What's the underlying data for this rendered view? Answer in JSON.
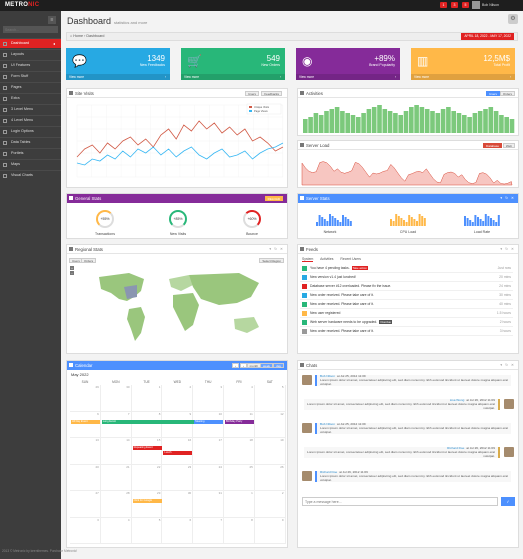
{
  "brand": {
    "name_a": "METRO",
    "name_b": "NIC"
  },
  "topbar": {
    "badges": [
      "1",
      "3",
      "5",
      "3"
    ],
    "user": "Bob Nilson"
  },
  "sidebar": {
    "search_placeholder": "Search...",
    "items": [
      "Dashboard",
      "Layouts",
      "UI Features",
      "Form Stuff",
      "Pages",
      "Extra",
      "3 Level Menu",
      "4 Level Menu",
      "Login Options",
      "Data Tables",
      "Portlets",
      "Maps",
      "Visual Charts"
    ]
  },
  "page": {
    "title": "Dashboard",
    "subtitle": "statistics and more"
  },
  "breadcrumb": {
    "home": "Home",
    "current": "Dashboard",
    "date_range": "APRIL 18, 2022 - MAY 17, 2022"
  },
  "stats": [
    {
      "icon": "comments-icon",
      "value": "1349",
      "label": "New Feedbacks",
      "more": "View more",
      "color": "#27a9e3"
    },
    {
      "icon": "cart-icon",
      "value": "549",
      "label": "New Orders",
      "more": "View more",
      "color": "#28b779"
    },
    {
      "icon": "globe-icon",
      "value": "+89%",
      "label": "Brand Popularity",
      "more": "View more",
      "color": "#852b99"
    },
    {
      "icon": "bar-chart-icon",
      "value": "12,5M$",
      "label": "Total Profit",
      "more": "View more",
      "color": "#ffb848"
    }
  ],
  "site_visits": {
    "title": "Site Visits",
    "buttons": [
      "Users",
      "Feedbacks"
    ],
    "legend": [
      "Unique Visits",
      "Page Views"
    ]
  },
  "activities": {
    "title": "Activities",
    "buttons": [
      "Users",
      "Orders"
    ]
  },
  "server_load": {
    "title": "Server Load",
    "buttons": [
      "Database",
      "Web"
    ]
  },
  "general_stats": {
    "title": "General Stats",
    "button": "RELOAD",
    "gauges": [
      {
        "value": "+55%",
        "label": "Transactions"
      },
      {
        "value": "+85%",
        "label": "New Visits"
      },
      {
        "value": "+60%",
        "label": "Bounce"
      }
    ]
  },
  "server_stats": {
    "title": "Server Stats",
    "labels": [
      "Network",
      "CPU Load",
      "Load Rate"
    ]
  },
  "regional": {
    "title": "Regional Stats",
    "tabs": [
      "Users",
      "Orders"
    ],
    "select": "Select Region"
  },
  "feeds": {
    "title": "Feeds",
    "tabs": [
      "System",
      "Activities",
      "Recent Users"
    ],
    "items": [
      {
        "text": "You have 4 pending tasks.",
        "badge": "Take action",
        "time": "Just now",
        "color": "#28b779"
      },
      {
        "text": "New version v1.4 just lunched!",
        "badge": "",
        "time": "20 mins",
        "color": "#27a9e3"
      },
      {
        "text": "Database server #12 overloaded. Please fix the issue.",
        "badge": "",
        "time": "24 mins",
        "color": "#e02222"
      },
      {
        "text": "New order received. Please take care of it.",
        "badge": "",
        "time": "30 mins",
        "color": "#27a9e3"
      },
      {
        "text": "New order received. Please take care of it.",
        "badge": "",
        "time": "40 mins",
        "color": "#28b779"
      },
      {
        "text": "New user registered",
        "badge": "",
        "time": "1.5 hours",
        "color": "#ffb848"
      },
      {
        "text": "Web server hardware needs to be upgraded.",
        "badge": "Overdue",
        "time": "2 hours",
        "color": "#28b779"
      },
      {
        "text": "New order received. Please take care of it.",
        "badge": "",
        "time": "3 hours",
        "color": "#999999"
      }
    ]
  },
  "calendar": {
    "title": "Calendar",
    "views": [
      "month",
      "week",
      "day"
    ],
    "month": "May 2022",
    "days": [
      "SUN",
      "MON",
      "TUE",
      "WED",
      "THU",
      "FRI",
      "SAT"
    ],
    "dates": [
      "29",
      "30",
      "1",
      "2",
      "3",
      "4",
      "5",
      "6",
      "7",
      "8",
      "9",
      "10",
      "11",
      "12",
      "13",
      "14",
      "15",
      "16",
      "17",
      "18",
      "19",
      "20",
      "21",
      "22",
      "23",
      "24",
      "25",
      "26",
      "27",
      "28",
      "29",
      "30",
      "31",
      "1",
      "2",
      "3",
      "4",
      "5",
      "6",
      "7",
      "8",
      "9"
    ],
    "events": [
      "All Day Event",
      "Long Event",
      "Lunch",
      "Repeating Event",
      "Meeting",
      "Birthday Party",
      "Click for Google"
    ]
  },
  "chats": {
    "title": "Chats",
    "messages": [
      {
        "who": "Bob Nilson",
        "time": "at Jul 25, 2012 11:09",
        "text": "Lorem ipsum dolor sit amet, consectetuer adipiscing elit, sed diam nonummy nibh euismod tincidunt ut laoreet dolore magna aliquam erat volutpat.",
        "out": false
      },
      {
        "who": "Lisa Wong",
        "time": "at Jul 26, 2012 11:09",
        "text": "Lorem ipsum dolor sit amet, consectetuer adipiscing elit, sed diam nonummy nibh euismod tincidunt ut laoreet dolore magna aliquam erat volutpat.",
        "out": true
      },
      {
        "who": "Bob Nilson",
        "time": "at Jul 25, 2012 11:09",
        "text": "Lorem ipsum dolor sit amet, consectetuer adipiscing elit, sed diam nonummy nibh euismod tincidunt ut laoreet dolore magna aliquam erat volutpat.",
        "out": false
      },
      {
        "who": "Richard Doe",
        "time": "at Jul 26, 2012 11:09",
        "text": "Lorem ipsum dolor sit amet, consectetuer adipiscing elit, sed diam nonummy nibh euismod tincidunt ut laoreet dolore magna aliquam erat volutpat.",
        "out": true
      },
      {
        "who": "Richard Doe",
        "time": "at Jul 26, 2012 11:09",
        "text": "Lorem ipsum dolor sit amet, consectetuer adipiscing elit, sed diam nonummy nibh euismod tincidunt ut laoreet dolore magna aliquam erat volutpat.",
        "out": false
      }
    ],
    "input_placeholder": "Type a message here...",
    "send": "✓"
  },
  "footer": "2013 © Metronic by keenthemes. Purchase Metronic!"
}
